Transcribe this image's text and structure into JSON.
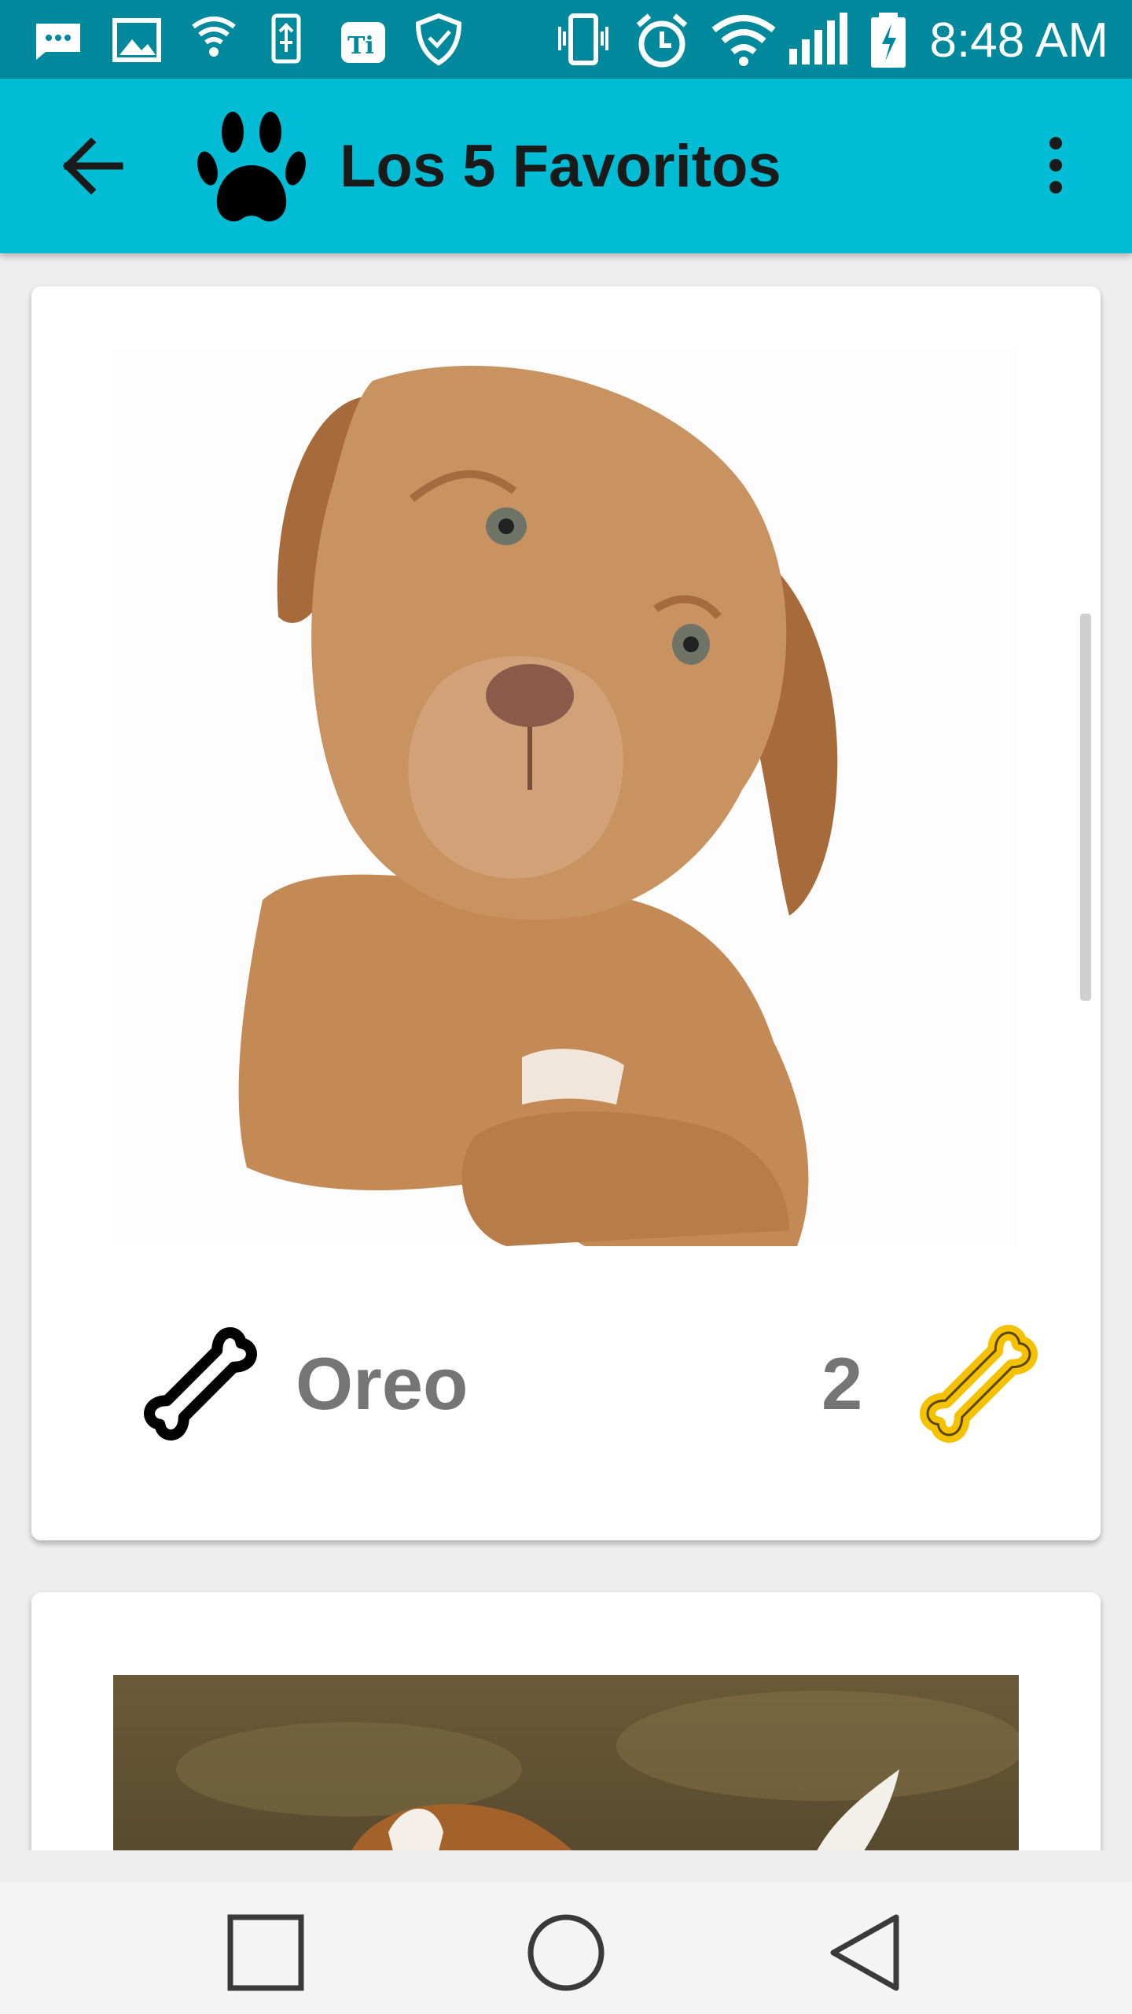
{
  "status_bar": {
    "time": "8:48 AM",
    "icons": [
      "messages-icon",
      "image-icon",
      "vpn-shield-icon",
      "usb-icon",
      "ti-app-icon",
      "security-shield-icon",
      "vibrate-icon",
      "alarm-icon",
      "wifi-icon",
      "signal-icon",
      "battery-charging-icon"
    ]
  },
  "app_bar": {
    "title": "Los 5 Favoritos",
    "back_icon": "arrow-back-icon",
    "logo_icon": "paw-icon",
    "menu_icon": "more-vert-icon"
  },
  "pets": [
    {
      "name": "Oreo",
      "likes": "2",
      "photo": "puppy-photo"
    },
    {
      "name": "",
      "likes": "",
      "photo": "beagle-photo"
    }
  ],
  "nav_bar": {
    "icons": [
      "recent-apps-icon",
      "home-icon",
      "back-triangle-icon"
    ]
  },
  "colors": {
    "status_bar": "#00889c",
    "app_bar": "#00bcd4",
    "bone_gold": "#f5c200",
    "text_gray": "#757575"
  }
}
